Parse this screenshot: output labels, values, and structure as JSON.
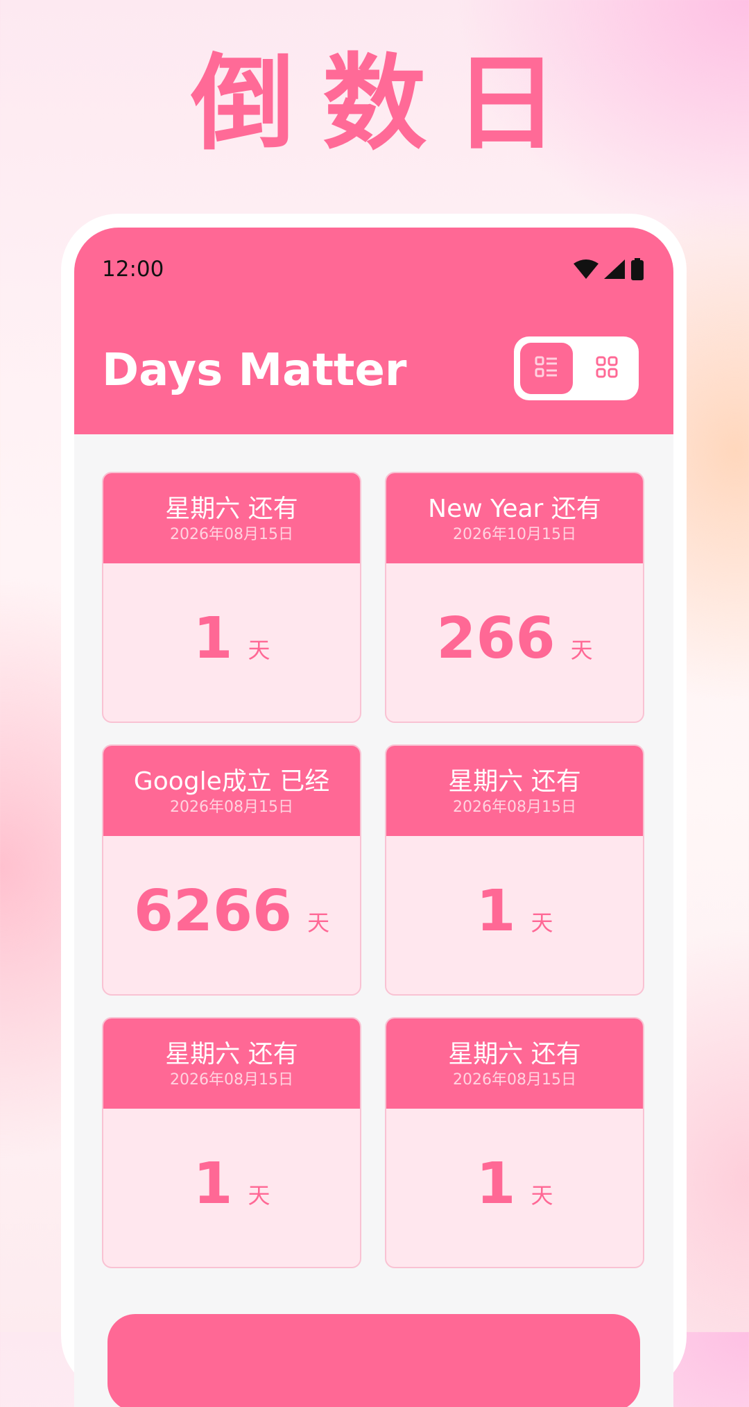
{
  "hero": {
    "title": "倒数日"
  },
  "status_bar": {
    "time": "12:00"
  },
  "header": {
    "title": "Days Matter"
  },
  "view_toggle": {
    "selected": "list"
  },
  "colors": {
    "accent": "#ff6895",
    "card_body": "#ffe7ee",
    "frame": "#ffffff"
  },
  "cards": [
    {
      "title": "星期六 还有",
      "date": "2026年08月15日",
      "count": "1",
      "unit": "天"
    },
    {
      "title": "New Year 还有",
      "date": "2026年10月15日",
      "count": "266",
      "unit": "天"
    },
    {
      "title": "Google成立 已经",
      "date": "2026年08月15日",
      "count": "6266",
      "unit": "天"
    },
    {
      "title": "星期六 还有",
      "date": "2026年08月15日",
      "count": "1",
      "unit": "天"
    },
    {
      "title": "星期六 还有",
      "date": "2026年08月15日",
      "count": "1",
      "unit": "天"
    },
    {
      "title": "星期六 还有",
      "date": "2026年08月15日",
      "count": "1",
      "unit": "天"
    }
  ]
}
